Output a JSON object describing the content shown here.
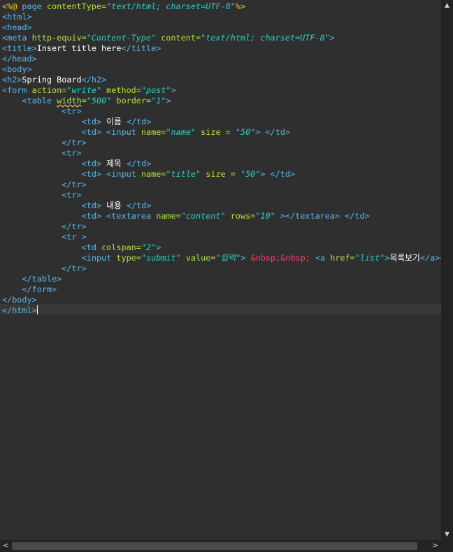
{
  "code_lines": [
    [
      "<%@",
      " page ",
      "contentType=",
      "\"text/html; charset=UTF-8\"",
      "%>"
    ],
    [
      "<html>"
    ],
    [
      "<head>"
    ],
    [
      "<meta",
      " http-equiv=",
      "\"Content-Type\"",
      " content=",
      "\"text/html; charset=UTF-8\"",
      ">"
    ],
    [
      "<title>",
      "Insert title here",
      "</title>"
    ],
    [
      "</head>"
    ],
    [
      "<body>"
    ],
    [
      "<h2>",
      "Spring Board",
      "</h2>"
    ],
    [
      "<form",
      " action=",
      "\"write\"",
      " method=",
      "\"post\"",
      ">"
    ],
    [
      "    ",
      "<table",
      " ",
      "width",
      "=",
      "\"500\"",
      " border=",
      "\"1\"",
      ">"
    ],
    [
      "            ",
      "<tr>"
    ],
    [
      "                ",
      "<td>",
      " 이름 ",
      "</td>"
    ],
    [
      "                ",
      "<td>",
      " ",
      "<input",
      " name=",
      "\"name\"",
      " size = ",
      "\"50\"",
      ">",
      " ",
      "</td>"
    ],
    [
      "            ",
      "</tr>"
    ],
    [
      "            ",
      "<tr>"
    ],
    [
      "                ",
      "<td>",
      " 제목 ",
      "</td>"
    ],
    [
      "                ",
      "<td>",
      " ",
      "<input",
      " name=",
      "\"title\"",
      " size = ",
      "\"50\"",
      ">",
      " ",
      "</td>"
    ],
    [
      "            ",
      "</tr>"
    ],
    [
      "            ",
      "<tr>"
    ],
    [
      "                ",
      "<td>",
      " 내용 ",
      "</td>"
    ],
    [
      "                ",
      "<td>",
      " ",
      "<textarea",
      " name=",
      "\"content\"",
      " rows=",
      "\"10\"",
      " >",
      "</textarea>",
      " ",
      "</td>"
    ],
    [
      "            ",
      "</tr>"
    ],
    [
      "            ",
      "<tr",
      " >"
    ],
    [
      "                ",
      "<td",
      " colspan=",
      "\"2\"",
      ">"
    ],
    [
      "                ",
      "<input",
      " type=",
      "\"submit\"",
      " value=",
      "\"입력\"",
      ">",
      " &nbsp;&nbsp; ",
      "<a",
      " href=",
      "\"list\"",
      ">",
      "목록보기",
      "</a>",
      "</t"
    ],
    [
      "            ",
      "</tr>"
    ],
    [
      "    ",
      "</table>"
    ],
    [
      "    ",
      "</form>"
    ],
    [
      "</body>"
    ],
    [
      "</html>"
    ]
  ],
  "scrollbar": {
    "up_arrow": "▲",
    "down_arrow": "▼",
    "left_arrow": "<",
    "right_arrow": ">"
  }
}
